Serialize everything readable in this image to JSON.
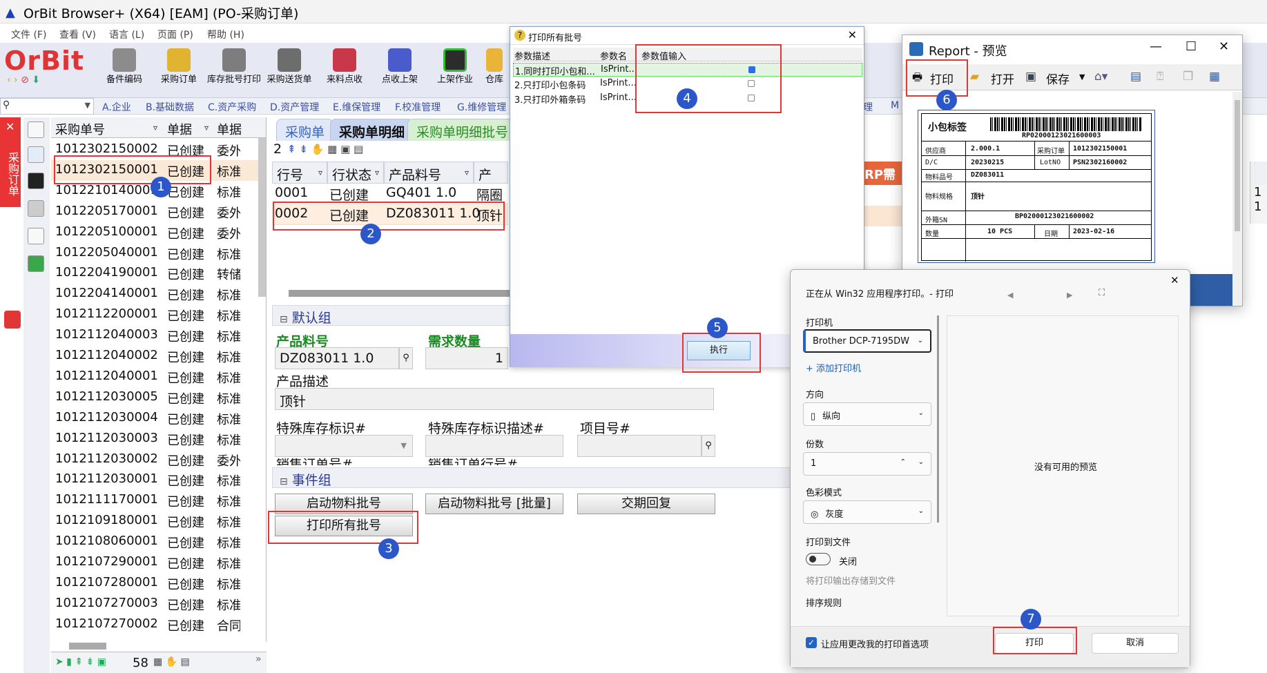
{
  "window": {
    "title": "OrBit Browser+ (X64) [EAM] (PO-采购订单)"
  },
  "menu": [
    "文件 (F)",
    "查看 (V)",
    "语言 (L)",
    "页面 (P)",
    "帮助 (H)"
  ],
  "logo": "OrBit",
  "toolbar": [
    "备件编码",
    "采购订单",
    "库存批号打印",
    "采购送货单",
    "来料点收",
    "点收上架",
    "上架作业",
    "仓库"
  ],
  "nav": [
    "A.企业",
    "B.基础数据",
    "C.资产采购",
    "D.资产管理",
    "E.维保管理",
    "F.校准管理",
    "G.维修管理",
    "理",
    "M"
  ],
  "left_tab": "采购订单",
  "list": {
    "headers": [
      "采购单号",
      "单据",
      "单据"
    ],
    "rows": [
      [
        "1012302150002",
        "已创建",
        "委外"
      ],
      [
        "1012302150001",
        "已创建",
        "标准"
      ],
      [
        "1012210140001",
        "已创建",
        "标准"
      ],
      [
        "1012205170001",
        "已创建",
        "委外"
      ],
      [
        "1012205100001",
        "已创建",
        "委外"
      ],
      [
        "1012205040001",
        "已创建",
        "标准"
      ],
      [
        "1012204190001",
        "已创建",
        "转储"
      ],
      [
        "1012204140001",
        "已创建",
        "标准"
      ],
      [
        "1012112200001",
        "已创建",
        "标准"
      ],
      [
        "1012112040003",
        "已创建",
        "标准"
      ],
      [
        "1012112040002",
        "已创建",
        "标准"
      ],
      [
        "1012112040001",
        "已创建",
        "标准"
      ],
      [
        "1012112030005",
        "已创建",
        "标准"
      ],
      [
        "1012112030004",
        "已创建",
        "标准"
      ],
      [
        "1012112030003",
        "已创建",
        "标准"
      ],
      [
        "1012112030002",
        "已创建",
        "委外"
      ],
      [
        "1012112030001",
        "已创建",
        "标准"
      ],
      [
        "1012111170001",
        "已创建",
        "标准"
      ],
      [
        "1012109180001",
        "已创建",
        "标准"
      ],
      [
        "1012108060001",
        "已创建",
        "标准"
      ],
      [
        "1012107290001",
        "已创建",
        "标准"
      ],
      [
        "1012107280001",
        "已创建",
        "标准"
      ],
      [
        "1012107270003",
        "已创建",
        "标准"
      ],
      [
        "1012107270002",
        "已创建",
        "合同"
      ]
    ],
    "count": "58"
  },
  "tabs": [
    "采购单",
    "采购单明细",
    "采购单明细批号"
  ],
  "detail": {
    "count": "2",
    "headers": [
      "行号",
      "行状态",
      "产品料号",
      "产品描"
    ],
    "rows": [
      [
        "0001",
        "已创建",
        "GQ401 1.0",
        "隔圈"
      ],
      [
        "0002",
        "已创建",
        "DZ083011 1.0",
        "顶针"
      ]
    ],
    "right_header": "RP需求"
  },
  "default_group": {
    "title": "默认组",
    "product_code_label": "产品料号",
    "product_code": "DZ083011 1.0",
    "qty_label": "需求数量",
    "qty": "1",
    "desc_label": "产品描述",
    "desc": "顶针",
    "special_stock_label": "特殊库存标识#",
    "special_stock_desc_label": "特殊库存标识描述#",
    "project_label": "项目号#",
    "cut_labels": [
      "销售订单号#",
      "销售订单行号#"
    ]
  },
  "event_group": {
    "title": "事件组",
    "btn1": "启动物料批号",
    "btn2": "启动物料批号 [批量]",
    "btn3": "交期回复",
    "btn4": "打印所有批号"
  },
  "print_dialog": {
    "title": "打印所有批号",
    "headers": [
      "参数描述",
      "参数名",
      "参数值输入"
    ],
    "rows": [
      [
        "1.同时打印小包和...",
        "IsPrint..."
      ],
      [
        "2.只打印小包条码",
        "IsPrint..."
      ],
      [
        "3.只打印外箱条码",
        "IsPrint..."
      ]
    ],
    "checks": [
      true,
      false,
      false
    ],
    "execute": "执行"
  },
  "report": {
    "title": "Report - 预览",
    "print": "打印",
    "open": "打开",
    "save": "保存",
    "label": {
      "title": "小包标签",
      "barcode_text": "RP02000123021600003",
      "supplier_label": "供应商",
      "supplier": "2.000.1",
      "po_label": "采购订单",
      "po": "1012302150001",
      "dc_label": "D/C",
      "dc": "20230215",
      "lot_label": "LotNO",
      "lot": "PSN2302160002",
      "part_label": "物料品号",
      "part": "DZ083011",
      "spec_label": "物料规格",
      "spec": "顶针",
      "sn_label": "外箱SN",
      "sn": "BP02000123021600002",
      "qty_label": "数量",
      "qty": "10 PCS",
      "date_label": "日期",
      "date": "2023-02-16"
    }
  },
  "win_print": {
    "header": "正在从 Win32 应用程序打印。- 打印",
    "printer_label": "打印机",
    "printer": "Brother DCP-7195DW",
    "add_printer": "添加打印机",
    "orientation_label": "方向",
    "orientation": "纵向",
    "copies_label": "份数",
    "copies": "1",
    "color_label": "色彩模式",
    "color": "灰度",
    "print_to_file_label": "打印到文件",
    "toggle": "关闭",
    "toggle_desc": "将打印输出存储到文件",
    "sort_label": "排序规则",
    "no_preview": "没有可用的预览",
    "apply_label": "让应用更改我的打印首选项",
    "print": "打印",
    "cancel": "取消"
  },
  "badges": [
    "1",
    "2",
    "3",
    "4",
    "5",
    "6",
    "7"
  ]
}
